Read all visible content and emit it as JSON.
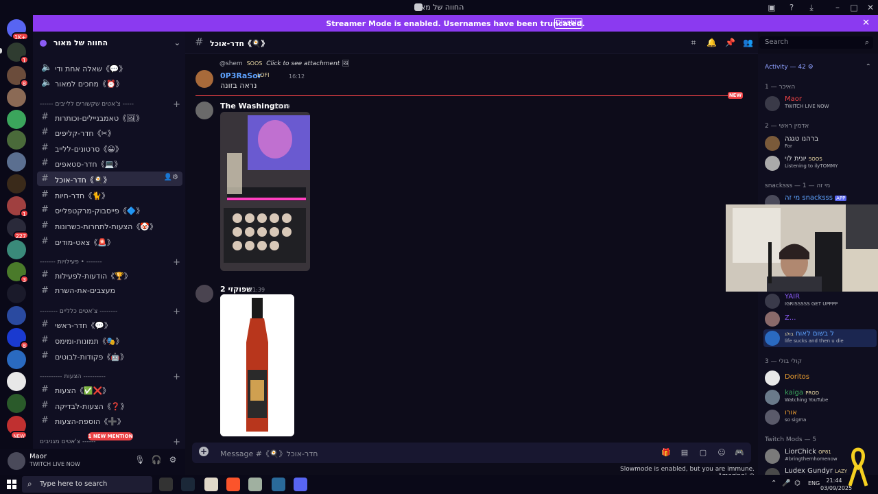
{
  "window": {
    "title": "החווה של מאור"
  },
  "banner": {
    "text": "Streamer Mode is enabled. Usernames have been truncated.",
    "disable_label": "Disable",
    "color": "#8b3af0"
  },
  "server_list": {
    "badges": [
      "1K+",
      "1",
      "8",
      "1",
      "227",
      "3",
      "1",
      "8"
    ],
    "new_label": "NEW"
  },
  "sidebar": {
    "server_name": "החווה של מאור",
    "channels_top": [
      {
        "label": "שאלה אחת ודי《💬》"
      },
      {
        "label": "מחכים למאור《⏰》"
      }
    ],
    "cat1": "------ צ'אטים שקשורים ללייבים -----",
    "cat1_channels": [
      {
        "label": "טאמבניילים-וכותרות《🖼》"
      },
      {
        "label": "חדר-קליפים《✂》"
      },
      {
        "label": "סרטונים-ללייב《😀》"
      },
      {
        "label": "חדר-סטאפים《💻》"
      },
      {
        "label": "חדר-אוכל《🍳》"
      },
      {
        "label": "חדר-חיות《🐈》"
      },
      {
        "label": "פייסבוק-מרקטפלייס《🔷》"
      },
      {
        "label": "הצעות-לתחרות-כשרונות《🤡》"
      },
      {
        "label": "צאט-מודים《🚨》"
      }
    ],
    "cat2": "------- פעילויות • -------",
    "cat2_channels": [
      {
        "label": "הודעות-לפעילות《🏆》"
      },
      {
        "label": "מעצבים-את-השרת"
      }
    ],
    "cat3": "-------- צ'אטים כלליים --------",
    "cat3_channels": [
      {
        "label": "חדר-ראשי《💬》"
      },
      {
        "label": "תמונות-ומימס《🎭》"
      },
      {
        "label": "פקודות-לבוטים《🤖》"
      }
    ],
    "cat4": "---------- הצעות ----------",
    "cat4_channels": [
      {
        "label": "הצעות《✅❌》"
      },
      {
        "label": "הצעות-לבדיקה《❓》"
      },
      {
        "label": "הוספת-הצעות《➕》"
      }
    ],
    "cat5": "צ'אטים מגניבים ------",
    "mention_pill": "1 NEW MENTION"
  },
  "userbar": {
    "name": "Maor",
    "status": "TWITCH LIVE NOW"
  },
  "chat": {
    "channel_name": "חדר-אוכל《🍳》",
    "messages": [
      {
        "reply_user": "@shem",
        "reply_tag": "SOOS",
        "reply_text": "Click to see attachment",
        "author": "0P3RaSor",
        "author_tag": "LOFI",
        "time": "16:12",
        "text": "נראה בזונה",
        "author_color": "#5ea3ff"
      },
      {
        "author": "The Washington",
        "time": "21:39"
      },
      {
        "author": "שפוקזי 2",
        "time": "21:39"
      }
    ],
    "new_tag": "NEW",
    "input_placeholder": "Message #《🍳》חדר-אוכל",
    "slowmode_text": "Slowmode is enabled, but you are immune. Amazing!"
  },
  "search": {
    "placeholder": "Search"
  },
  "activity": {
    "header": "Activity — 42",
    "sections": [
      {
        "title": "האיכר — 1"
      },
      {
        "title": "אדמין ראשי — 2"
      },
      {
        "title": "snacksss — 1 — מי זה"
      },
      {
        "title": "קולי בולי — 3"
      },
      {
        "title": "Twitch Mods — 5"
      }
    ],
    "members": [
      {
        "name": "Maor",
        "status": "TWITCH LIVE NOW",
        "color": "#ed4245"
      },
      {
        "name": "ברהנו טגגה",
        "status": "For",
        "color": "#dcddde"
      },
      {
        "name": "יונית לוי",
        "tag": "SOOS",
        "status": "Listening to ilyTOMMY",
        "color": "#dcddde"
      },
      {
        "name": "מי זה snacksss",
        "tag": "APP",
        "status": "",
        "color": "#5ea3ff"
      },
      {
        "name": "YAIR",
        "status": "IGRISSSSS GET UPPPP",
        "color": "#8b5cf6"
      },
      {
        "name": "Z...",
        "status": "",
        "color": "#8b5cf6"
      },
      {
        "name": "ל בשום לאוח",
        "tag": "בולג",
        "status": "life sucks and then u die",
        "color": "#5ea3ff"
      },
      {
        "name": "Doritos",
        "status": "",
        "color": "#f0a030"
      },
      {
        "name": "kaiga",
        "tag": "PROD",
        "status": "Watching YouTube",
        "color": "#3ba55c"
      },
      {
        "name": "אורו",
        "status": "so sigma",
        "color": "#f0a030"
      },
      {
        "name": "LiorChick",
        "tag": "OP81",
        "status": "#bringthemhomenow",
        "color": "#dcddde"
      },
      {
        "name": "Ludex Gundyr",
        "tag": "LAZY",
        "status": "",
        "color": "#dcddde"
      }
    ]
  },
  "taskbar": {
    "search_placeholder": "Type here to search",
    "lang": "ENG",
    "time": "21:44",
    "date": "03/09/2025"
  }
}
